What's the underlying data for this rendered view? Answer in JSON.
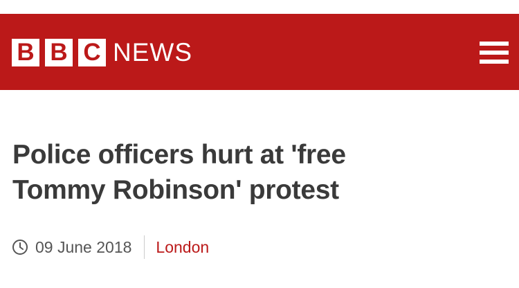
{
  "masthead": {
    "logo_letters": [
      "B",
      "B",
      "C"
    ],
    "logo_word": "NEWS",
    "menu_icon": "hamburger-menu-icon",
    "brand_color": "#bb1919"
  },
  "article": {
    "headline_line1": "Police officers hurt at 'free",
    "headline_line2": "Tommy Robinson' protest",
    "date": "09 June 2018",
    "section": "London",
    "date_icon": "clock-icon"
  }
}
